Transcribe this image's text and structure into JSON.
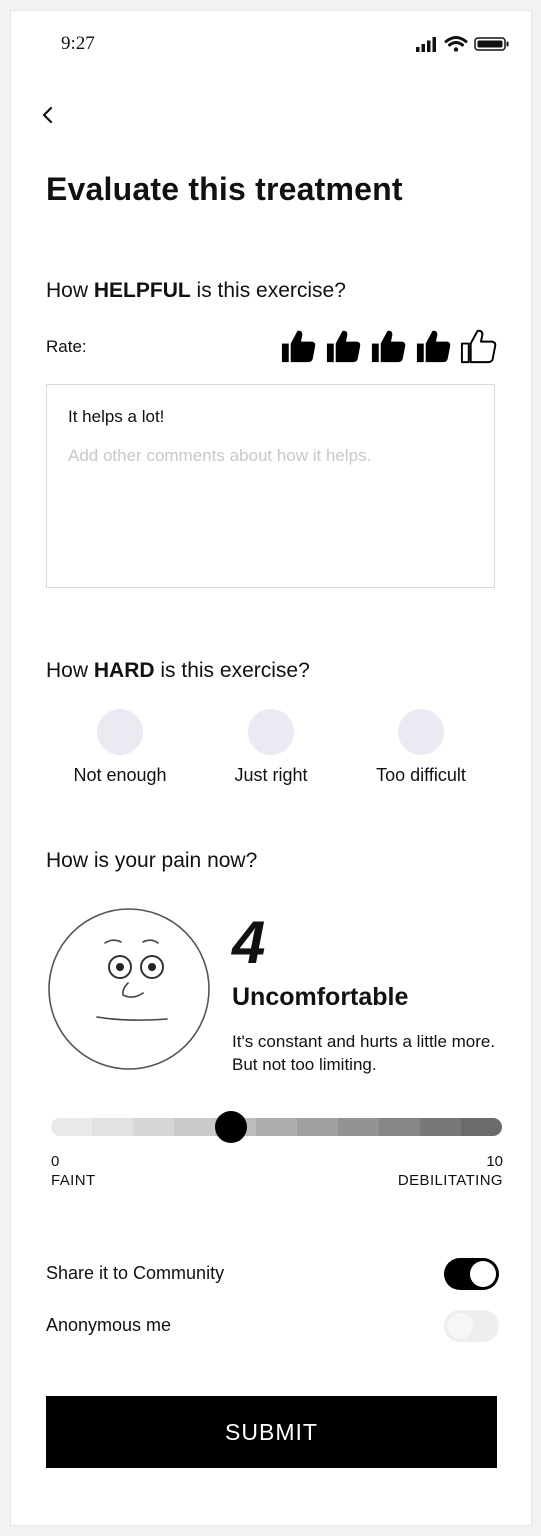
{
  "status_bar": {
    "time": "9:27"
  },
  "header": {
    "title": "Evaluate this treatment"
  },
  "helpful": {
    "question_prefix": "How",
    "question_emph": "HELPFUL",
    "question_suffix": "is this exercise?",
    "rate_label": "Rate:",
    "rating": 4,
    "rating_max": 5,
    "comment_value": "It helps a lot!",
    "comment_placeholder": "Add other comments about how it helps."
  },
  "hard": {
    "question_prefix": "How",
    "question_emph": "HARD",
    "question_suffix": "is this exercise?",
    "options": [
      "Not enough",
      "Just right",
      "Too difficult"
    ]
  },
  "pain": {
    "question": "How is your pain now?",
    "value": "4",
    "label": "Uncomfortable",
    "description": "It's constant and hurts a little more. But not too limiting.",
    "slider_value": 4,
    "scale_min": "0",
    "scale_min_label": "FAINT",
    "scale_max": "10",
    "scale_max_label": "DEBILITATING"
  },
  "toggles": {
    "share_label": "Share it to Community",
    "share_on": true,
    "anonymous_label": "Anonymous me",
    "anonymous_on": false
  },
  "submit_label": "SUBMIT",
  "icons": {
    "back": "chevron-left-icon",
    "thumb_filled": "thumbs-up-filled-icon",
    "thumb_outline": "thumbs-up-outline-icon",
    "face": "uncomfortable-face-icon"
  },
  "colors": {
    "accent": "#000000",
    "option_circle": "#e9eaf2",
    "placeholder": "#c8c8c8",
    "pain_gradient": [
      "#e9e9e9",
      "#e2e2e2",
      "#d6d6d6",
      "#c9c9c9",
      "#bcbcbc",
      "#aeaeae",
      "#a0a0a0",
      "#939393",
      "#868686",
      "#787878",
      "#6b6b6b"
    ]
  }
}
